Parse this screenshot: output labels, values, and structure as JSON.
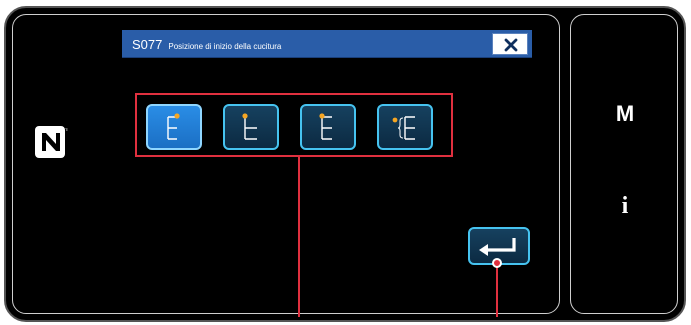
{
  "dialog": {
    "code": "S077",
    "title": "Posizione di inizio della cucitura",
    "close_icon": "close-icon"
  },
  "position_buttons": [
    {
      "name": "start-position-top-right-button",
      "icon": "stitch-start-top-right-icon",
      "selected": true
    },
    {
      "name": "start-position-top-center-button",
      "icon": "stitch-start-top-center-icon",
      "selected": false
    },
    {
      "name": "start-position-top-left-button",
      "icon": "stitch-start-top-left-icon",
      "selected": false
    },
    {
      "name": "start-position-outside-left-button",
      "icon": "stitch-start-outside-left-icon",
      "selected": false
    }
  ],
  "enter_button": {
    "icon": "enter-icon"
  },
  "side_panel": {
    "menu_key": "M",
    "info_key": "i"
  },
  "colors": {
    "header_blue": "#2a5da8",
    "button_border": "#46c3f0",
    "selected_button": "#1b6fc4",
    "start_dot": "#f5a623",
    "callout_red": "#e0303f"
  }
}
